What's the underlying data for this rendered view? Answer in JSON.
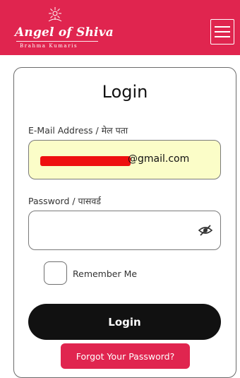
{
  "header": {
    "brand_name": "Angel of Shiva",
    "brand_subtitle": "Brahma Kumaris",
    "menu_icon": "hamburger-menu-icon",
    "background_color": "#e0254f"
  },
  "login": {
    "title": "Login",
    "email_label": "E-Mail Address / मेल पता",
    "email_value_visible": "@gmail.com",
    "password_label": "Password / पासवर्ड",
    "password_toggle_icon": "eye-slash-icon",
    "remember_label": "Remember Me",
    "submit_label": "Login",
    "forgot_label": "Forgot Your Password?"
  }
}
